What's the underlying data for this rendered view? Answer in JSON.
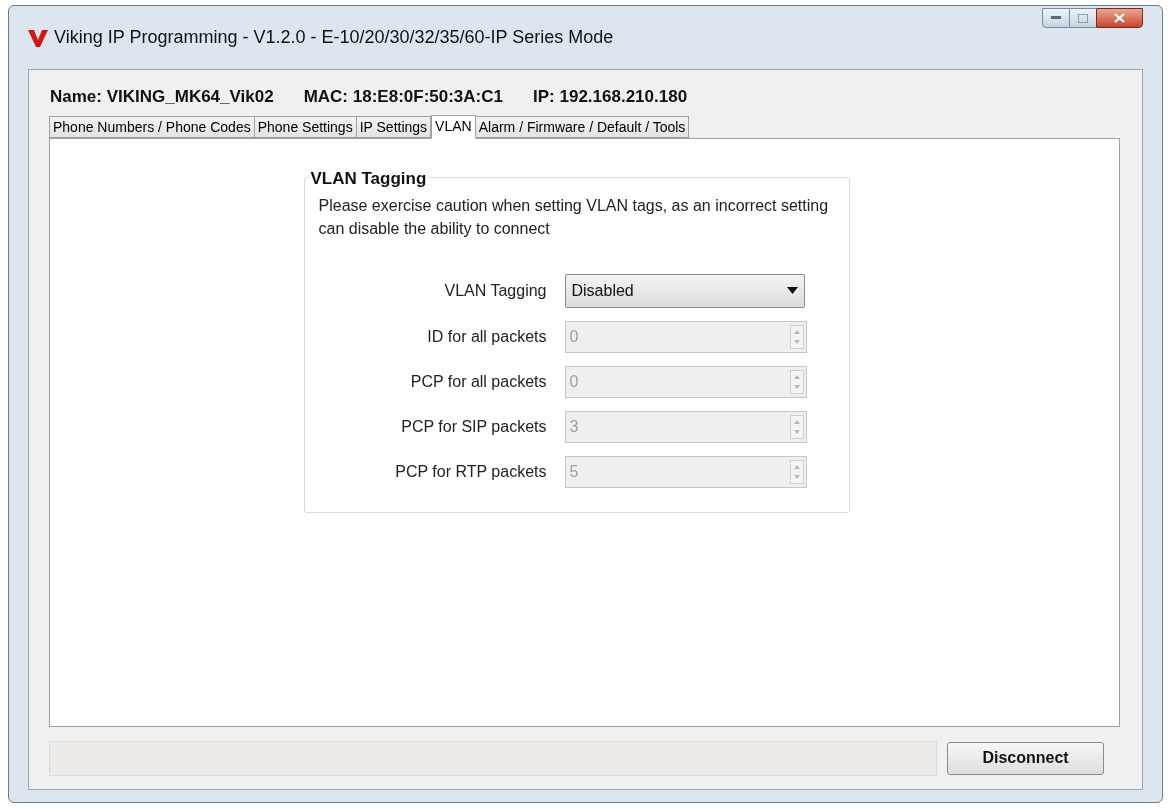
{
  "window": {
    "title": "Viking IP Programming - V1.2.0 - E-10/20/30/32/35/60-IP Series Mode"
  },
  "device_info": [
    {
      "label": "Name:",
      "value": "VIKING_MK64_Vik02"
    },
    {
      "label": "MAC:",
      "value": "18:E8:0F:50:3A:C1"
    },
    {
      "label": "IP:",
      "value": "192.168.210.180"
    }
  ],
  "tabs": [
    {
      "label": "Phone Numbers / Phone Codes",
      "selected": false
    },
    {
      "label": "Phone Settings",
      "selected": false
    },
    {
      "label": "IP Settings",
      "selected": false
    },
    {
      "label": "VLAN",
      "selected": true
    },
    {
      "label": "Alarm / Firmware / Default / Tools",
      "selected": false
    }
  ],
  "group": {
    "title": "VLAN Tagging",
    "warning": "Please exercise caution when setting VLAN tags, as an incorrect setting can disable the ability to connect",
    "fields": [
      {
        "kind": "select",
        "label": "VLAN Tagging",
        "value": "Disabled",
        "disabled": false
      },
      {
        "kind": "spin",
        "label": "ID for all packets",
        "value": "0",
        "disabled": true
      },
      {
        "kind": "spin",
        "label": "PCP for all packets",
        "value": "0",
        "disabled": true
      },
      {
        "kind": "spin",
        "label": "PCP for SIP packets",
        "value": "3",
        "disabled": true
      },
      {
        "kind": "spin",
        "label": "PCP for RTP packets",
        "value": "5",
        "disabled": true
      }
    ]
  },
  "buttons": [
    "Disconnect"
  ]
}
